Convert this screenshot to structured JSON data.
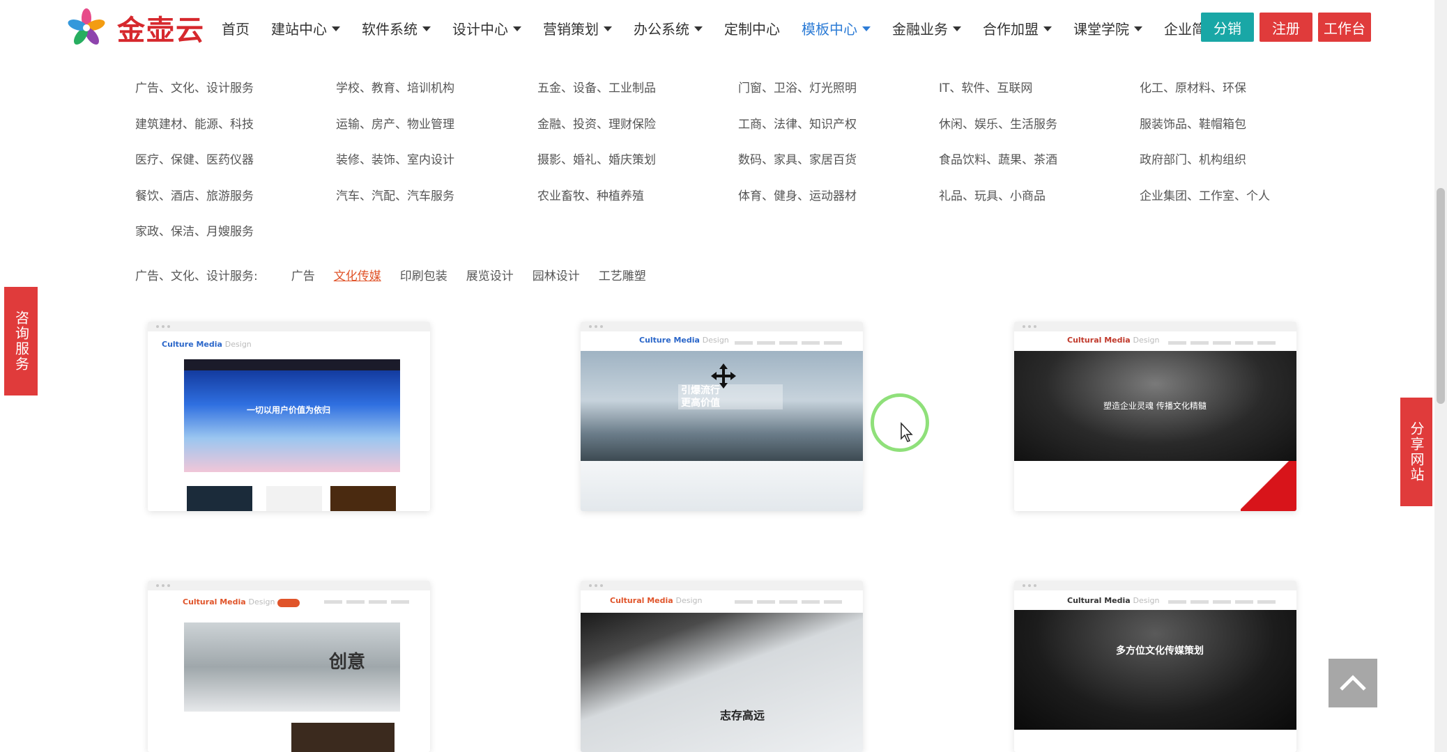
{
  "header": {
    "brand": "金壶云",
    "nav": [
      {
        "label": "首页",
        "dropdown": false
      },
      {
        "label": "建站中心",
        "dropdown": true
      },
      {
        "label": "软件系统",
        "dropdown": true
      },
      {
        "label": "设计中心",
        "dropdown": true
      },
      {
        "label": "营销策划",
        "dropdown": true
      },
      {
        "label": "办公系统",
        "dropdown": true
      },
      {
        "label": "定制中心",
        "dropdown": false
      },
      {
        "label": "模板中心",
        "dropdown": true,
        "active": true
      },
      {
        "label": "金融业务",
        "dropdown": true
      },
      {
        "label": "合作加盟",
        "dropdown": true
      },
      {
        "label": "课堂学院",
        "dropdown": true
      },
      {
        "label": "企业简介",
        "dropdown": true
      }
    ],
    "buttons": {
      "share": "分销",
      "register": "注册",
      "workbench": "工作台"
    }
  },
  "categories": [
    "广告、文化、设计服务",
    "学校、教育、培训机构",
    "五金、设备、工业制品",
    "门窗、卫浴、灯光照明",
    "IT、软件、互联网",
    "化工、原材料、环保",
    "建筑建材、能源、科技",
    "运输、房产、物业管理",
    "金融、投资、理财保险",
    "工商、法律、知识产权",
    "休闲、娱乐、生活服务",
    "服装饰品、鞋帽箱包",
    "医疗、保健、医药仪器",
    "装修、装饰、室内设计",
    "摄影、婚礼、婚庆策划",
    "数码、家具、家居百货",
    "食品饮料、蔬果、茶酒",
    "政府部门、机构组织",
    "餐饮、酒店、旅游服务",
    "汽车、汽配、汽车服务",
    "农业畜牧、种植养殖",
    "体育、健身、运动器材",
    "礼品、玩具、小商品",
    "企业集团、工作室、个人",
    "家政、保洁、月嫂服务"
  ],
  "filter": {
    "label": "广告、文化、设计服务:",
    "tags": [
      "广告",
      "文化传媒",
      "印刷包装",
      "展览设计",
      "园林设计",
      "工艺雕塑"
    ],
    "active_tag": "文化传媒"
  },
  "templates": [
    {
      "title": "Culture Media",
      "title_suffix": "Design",
      "hero_text": "一切以用户价值为依归",
      "title_color": "#2a66c9"
    },
    {
      "title": "Culture Media",
      "title_suffix": "Design",
      "hero_text": "引爆流行 更高价值",
      "title_color": "#2a66c9"
    },
    {
      "title": "Cultural Media",
      "title_suffix": "Design",
      "hero_text": "塑造企业灵魂 传播文化精髓",
      "title_color": "#c0392b"
    },
    {
      "title": "Cultural Media",
      "title_suffix": "Design",
      "hero_text": "创意",
      "title_color": "#e0542a"
    },
    {
      "title": "Cultural Media",
      "title_suffix": "Design",
      "hero_text": "志存高远",
      "title_color": "#e0542a"
    },
    {
      "title": "Cultural Media",
      "title_suffix": "Design",
      "hero_text": "多方位文化传媒策划",
      "title_color": "#333333"
    }
  ],
  "side": {
    "left": "咨询服务",
    "right": "分享网站"
  },
  "icons": [
    "logo-flower-icon",
    "caret-down-icon",
    "back-to-top-icon",
    "move-cursor-icon",
    "mouse-pointer-icon"
  ],
  "colors": {
    "accent_blue": "#2d7cd6",
    "brand_red": "#e03b3b",
    "teal": "#19a7a6",
    "active_orange": "#e0542a"
  }
}
